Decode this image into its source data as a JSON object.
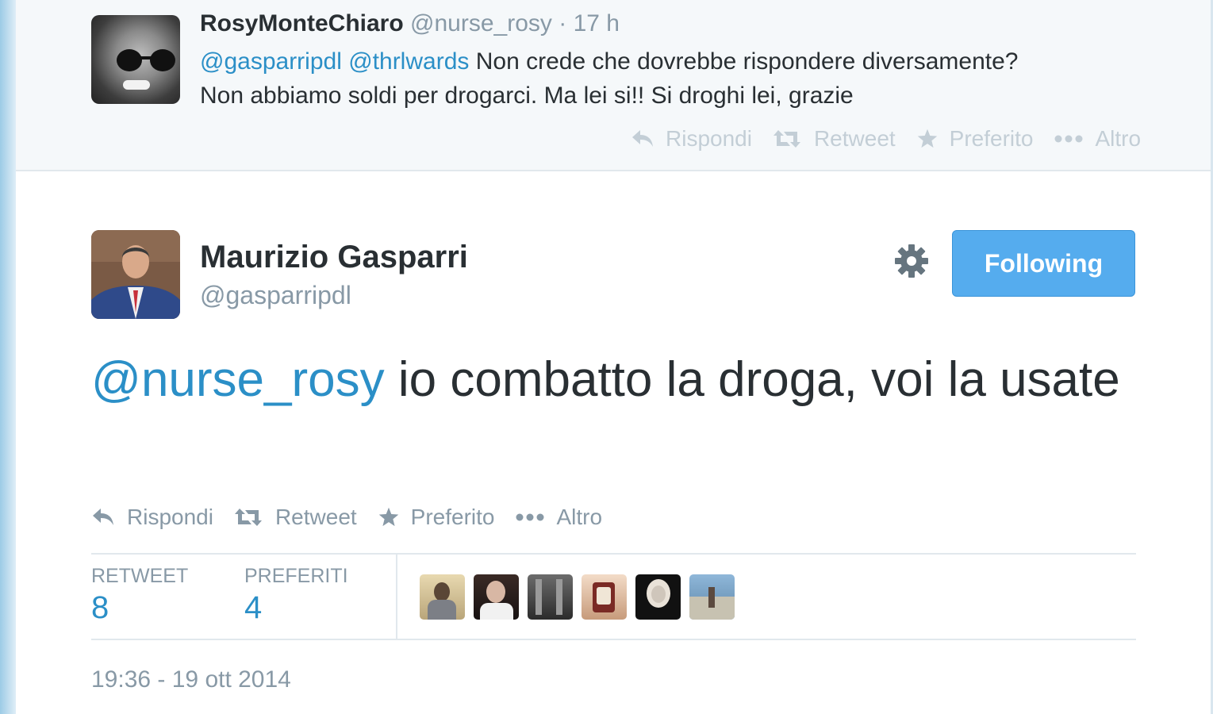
{
  "reply_tweet": {
    "fullname": "RosyMonteChiaro",
    "handle": "@nurse_rosy",
    "separator": "·",
    "time": "17 h",
    "mention_1": "@gasparripdl",
    "mention_2": "@thrlwards",
    "text_line_1": "Non crede che dovrebbe rispondere diversamente?",
    "text_line_2": "Non abbiamo soldi per drogarci. Ma lei si!! Si droghi lei, grazie",
    "actions": {
      "reply": "Rispondi",
      "retweet": "Retweet",
      "favorite": "Preferito",
      "more": "Altro"
    }
  },
  "main_tweet": {
    "fullname": "Maurizio Gasparri",
    "handle": "@gasparripdl",
    "follow_button": "Following",
    "mention": "@nurse_rosy",
    "text": "io combatto la droga, voi la usate",
    "actions": {
      "reply": "Rispondi",
      "retweet": "Retweet",
      "favorite": "Preferito",
      "more": "Altro"
    },
    "stats": {
      "retweet_label": "RETWEET",
      "retweet_count": "8",
      "favorites_label": "PREFERITI",
      "favorites_count": "4"
    },
    "timestamp": "19:36 - 19 ott 2014"
  },
  "colors": {
    "link": "#2b8fc7",
    "follow_button": "#55acee",
    "muted_text": "#8899a6",
    "reply_background": "#f5f8fa"
  },
  "icons": [
    "reply-icon",
    "retweet-icon",
    "star-icon",
    "more-icon",
    "gear-icon"
  ]
}
